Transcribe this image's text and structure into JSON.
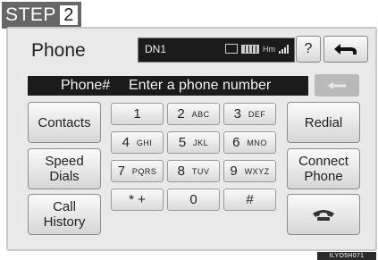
{
  "step": {
    "label": "STEP",
    "number": "2"
  },
  "header": {
    "title": "Phone",
    "device_name": "DN1",
    "status_text": "Hm",
    "help_label": "?"
  },
  "number_field": {
    "label": "Phone#",
    "placeholder": "Enter a phone number"
  },
  "left_buttons": {
    "contacts": "Contacts",
    "speed_dials": [
      "Speed",
      "Dials"
    ],
    "call_history": [
      "Call",
      "History"
    ]
  },
  "right_buttons": {
    "redial": "Redial",
    "connect_phone": [
      "Connect",
      "Phone"
    ]
  },
  "keypad": [
    {
      "digit": "1",
      "letters": ""
    },
    {
      "digit": "2",
      "letters": "ABC"
    },
    {
      "digit": "3",
      "letters": "DEF"
    },
    {
      "digit": "4",
      "letters": "GHI"
    },
    {
      "digit": "5",
      "letters": "JKL"
    },
    {
      "digit": "6",
      "letters": "MNO"
    },
    {
      "digit": "7",
      "letters": "PQRS"
    },
    {
      "digit": "8",
      "letters": "TUV"
    },
    {
      "digit": "9",
      "letters": "WXYZ"
    },
    {
      "digit": "* +",
      "letters": ""
    },
    {
      "digit": "0",
      "letters": ""
    },
    {
      "digit": "#",
      "letters": ""
    }
  ],
  "icons": {
    "back": "back-arrow-icon",
    "delete": "backspace-arrow-icon",
    "call": "phone-handset-icon"
  },
  "caption": "ILYO5H071"
}
